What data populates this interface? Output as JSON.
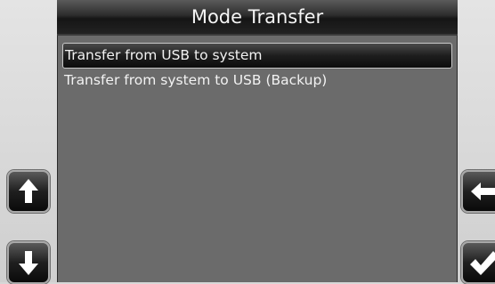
{
  "window": {
    "title": "Mode Transfer"
  },
  "list": {
    "items": [
      {
        "label": "Transfer from USB to system",
        "selected": true
      },
      {
        "label": "Transfer from system to USB (Backup)",
        "selected": false
      }
    ]
  },
  "buttons": {
    "scroll_up": {
      "icon": "arrow-up-icon"
    },
    "scroll_down": {
      "icon": "arrow-down-icon"
    },
    "back": {
      "icon": "arrow-left-icon"
    },
    "confirm": {
      "icon": "checkmark-icon"
    }
  }
}
